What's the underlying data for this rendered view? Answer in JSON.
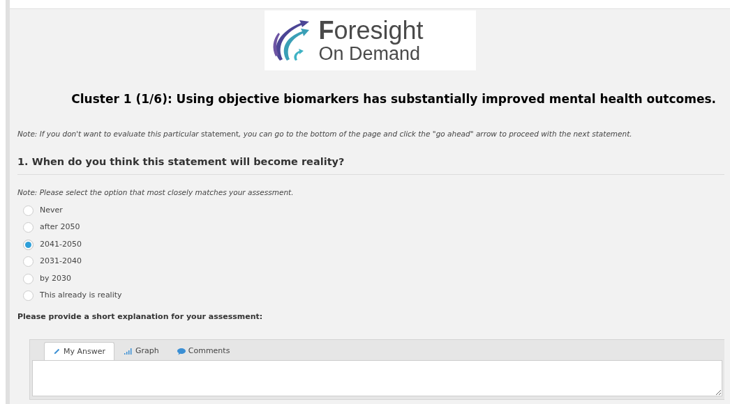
{
  "logo": {
    "line_1": "**F**oresight",
    "line_2": "On Demand"
  },
  "title": "Cluster 1 (1/6): Using objective biomarkers has substantially improved mental health outcomes.",
  "note": [
    {
      "text": "Note: If you don't want to evaluate this particular ",
      "italic": true
    },
    {
      "text": "statement",
      "italic": false
    },
    {
      "text": ", you can go to the bottom of the page and click the \"go ahead\" arrow to proceed with the next statement.",
      "italic": true
    }
  ],
  "question": {
    "heading": "1. When do you think this statement will become reality?",
    "note": "Note: Please select the option that most closely matches your assessment.",
    "options": [
      {
        "label": "Never",
        "selected": false
      },
      {
        "label": "after 2050",
        "selected": false
      },
      {
        "label": "2041-2050",
        "selected": true
      },
      {
        "label": "2031-2040",
        "selected": false
      },
      {
        "label": "by 2030",
        "selected": false
      },
      {
        "label": "This already is reality",
        "selected": false
      }
    ]
  },
  "explanation_label": "Please provide a short explanation for your assessment:",
  "tabs": [
    {
      "label": "My Answer",
      "kind": "pencil",
      "selected": true
    },
    {
      "label": "Graph",
      "kind": "bars",
      "selected": false
    },
    {
      "label": "Comments",
      "kind": "bubble",
      "selected": false
    }
  ]
}
